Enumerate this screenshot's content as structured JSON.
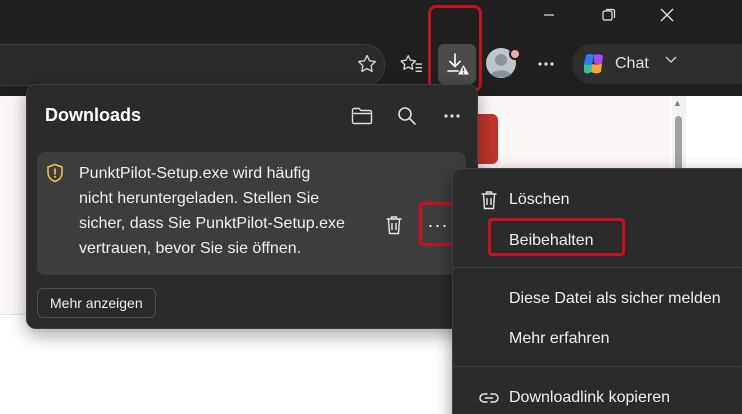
{
  "chat": {
    "label": "Chat"
  },
  "downloads": {
    "title": "Downloads",
    "item": {
      "warning_lines": [
        "PunktPilot-Setup.exe wird häufig",
        "nicht heruntergeladen. Stellen Sie",
        "sicher, dass Sie PunktPilot-Setup.exe",
        "vertrauen, bevor Sie sie öffnen."
      ],
      "more_label": "···"
    },
    "show_more_label": "Mehr anzeigen"
  },
  "context_menu": {
    "delete_label": "Löschen",
    "keep_label": "Beibehalten",
    "mark_safe_label": "Diese Datei als sicher melden",
    "learn_more_label": "Mehr erfahren",
    "copy_link_label": "Downloadlink kopieren"
  },
  "icons": [
    "minimize-icon",
    "maximize-icon",
    "close-icon",
    "star-icon",
    "favorites-icon",
    "download-icon",
    "avatar",
    "more-icon",
    "copilot-icon",
    "chevron-down-icon",
    "folder-icon",
    "search-icon",
    "warning-shield-icon",
    "trash-icon",
    "link-icon"
  ],
  "colors": {
    "annotation": "#c8101e",
    "flyout_bg": "#2b2b2b",
    "item_bg": "#3d3d3d",
    "warning": "#f2c94c"
  }
}
